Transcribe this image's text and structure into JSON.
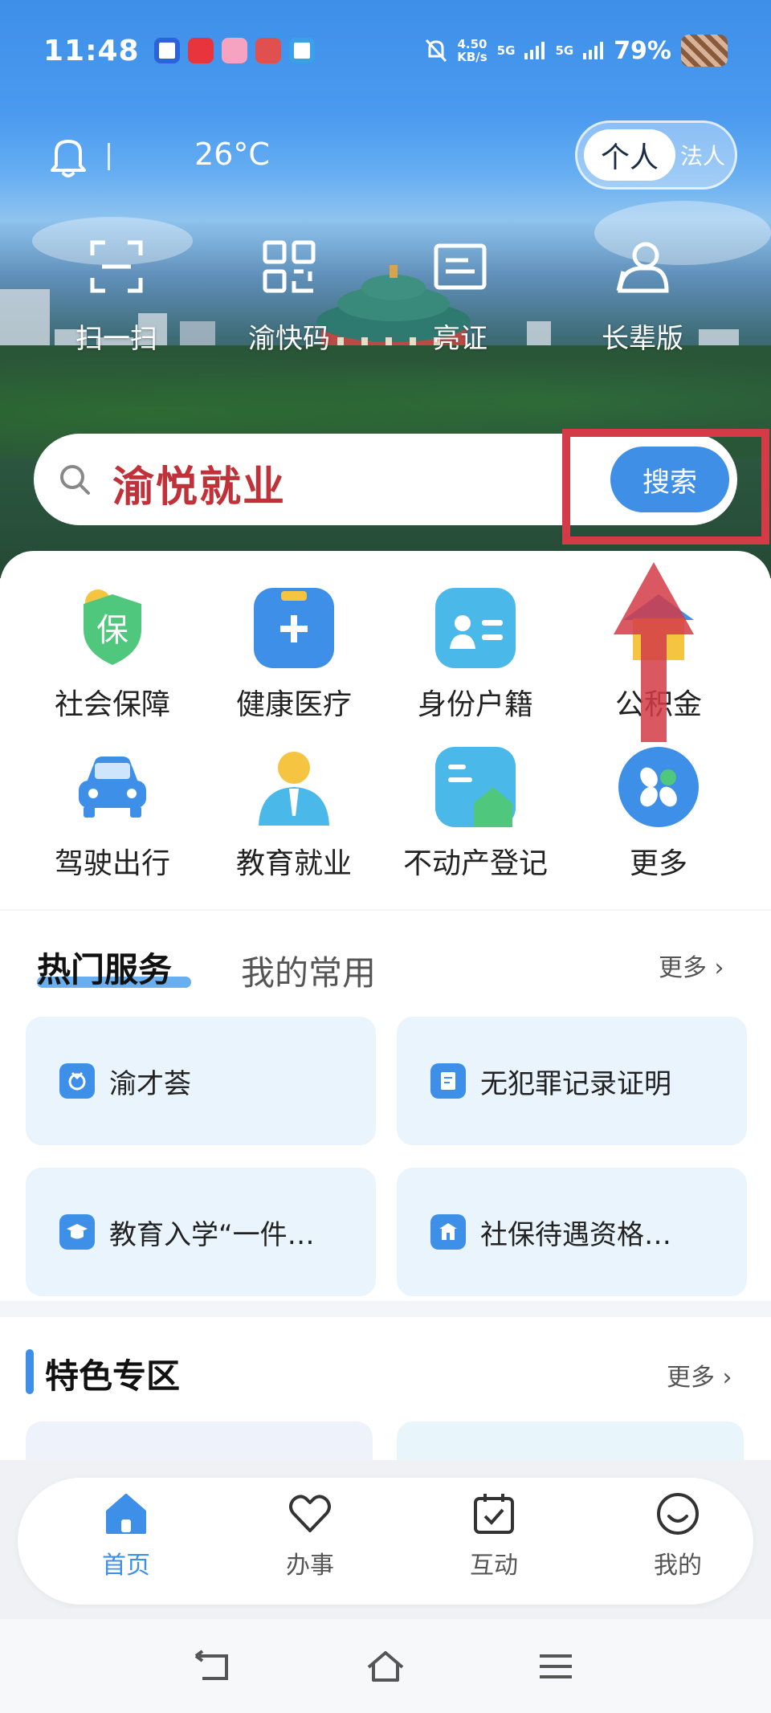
{
  "status_bar": {
    "time": "11:48",
    "net_speed_value": "4.50",
    "net_speed_unit": "KB/s",
    "signal_1": "5G",
    "signal_2": "5G",
    "battery": "79%"
  },
  "topbar": {
    "temperature": "26°C",
    "identity_toggle": {
      "selected": "个人",
      "other": "法人"
    }
  },
  "quick_actions": [
    {
      "label": "扫一扫",
      "icon": "scan-icon"
    },
    {
      "label": "渝快码",
      "icon": "qr-code-icon"
    },
    {
      "label": "亮证",
      "icon": "id-card-icon"
    },
    {
      "label": "长辈版",
      "icon": "elder-user-icon"
    }
  ],
  "search": {
    "value": "渝悦就业",
    "button_label": "搜索"
  },
  "categories": [
    {
      "label": "社会保障",
      "icon": "shield-icon",
      "glyph": "保"
    },
    {
      "label": "健康医疗",
      "icon": "medical-kit-icon"
    },
    {
      "label": "身份户籍",
      "icon": "id-card-icon"
    },
    {
      "label": "公积金",
      "icon": "house-fund-icon"
    },
    {
      "label": "驾驶出行",
      "icon": "car-icon"
    },
    {
      "label": "教育就业",
      "icon": "teacher-icon"
    },
    {
      "label": "不动产登记",
      "icon": "property-icon"
    },
    {
      "label": "更多",
      "icon": "more-apps-icon"
    }
  ],
  "hot_services": {
    "tab_active": "热门服务",
    "tab_inactive": "我的常用",
    "more_label": "更多",
    "items": [
      {
        "label": "渝才荟",
        "icon": "talent-icon"
      },
      {
        "label": "无犯罪记录证明",
        "icon": "certificate-icon"
      },
      {
        "label": "教育入学“一件…",
        "icon": "graduation-cap-icon"
      },
      {
        "label": "社保待遇资格…",
        "icon": "building-icon"
      }
    ]
  },
  "featured": {
    "title": "特色专区",
    "more_label": "更多"
  },
  "bottom_nav": [
    {
      "label": "首页",
      "icon": "home-icon",
      "active": true
    },
    {
      "label": "办事",
      "icon": "heart-icon",
      "active": false
    },
    {
      "label": "互动",
      "icon": "calendar-check-icon",
      "active": false
    },
    {
      "label": "我的",
      "icon": "smile-icon",
      "active": false
    }
  ],
  "colors": {
    "primary": "#3d8fe8",
    "annotation_red": "#d43b46",
    "search_text": "#c0313a",
    "card_bg": "#e9f4fd"
  }
}
